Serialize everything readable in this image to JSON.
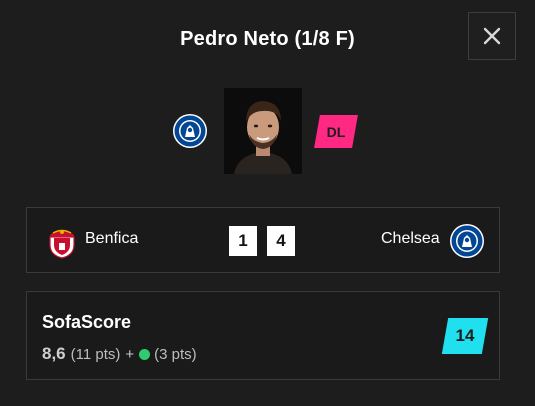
{
  "header": {
    "title": "Pedro Neto (1/8 F)",
    "close_label": "✕"
  },
  "player": {
    "position": "DL",
    "position_color": "#ff2882",
    "team_crest": "chelsea-crest-icon",
    "photo": "player-photo"
  },
  "match": {
    "home_team": "Benfica",
    "home_score": "1",
    "away_score": "4",
    "away_team": "Chelsea",
    "home_crest": "benfica-crest-icon",
    "away_crest": "chelsea-crest-icon"
  },
  "rating": {
    "title": "SofaScore",
    "value": "8,6",
    "points": "(11 pts)",
    "plus": "+",
    "bonus_points": "(3 pts)",
    "bonus_color": "#2ecc71",
    "badge_score": "14",
    "badge_color": "#20e0f0"
  }
}
